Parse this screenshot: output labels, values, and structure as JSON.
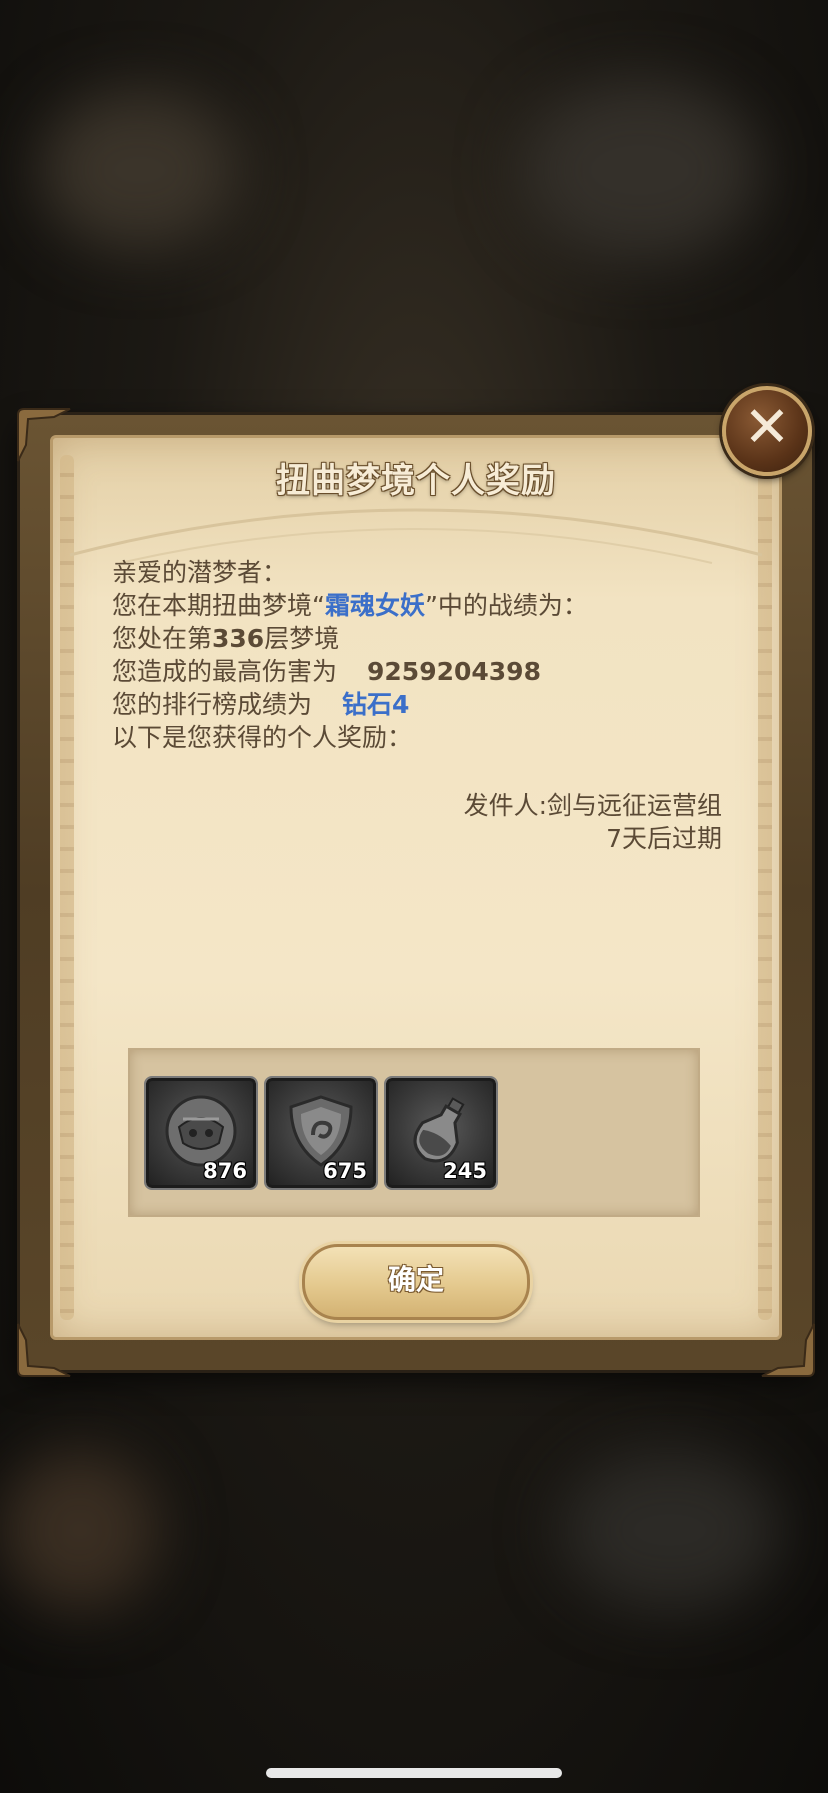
{
  "dialog": {
    "title": "扭曲梦境个人奖励",
    "greeting": "亲爱的潜梦者：",
    "line2_prefix": "您在本期扭曲梦境“",
    "boss_name": "霜魂女妖",
    "line2_suffix": "”中的战绩为：",
    "line3_prefix": "您处在第",
    "floor": "336",
    "line3_suffix": "层梦境",
    "line4_label": "您造成的最高伤害为",
    "damage": "9259204398",
    "line5_label": "您的排行榜成绩为",
    "rank": "钻石4",
    "line6": "以下是您获得的个人奖励：",
    "sender": "发件人:剑与远征运营组",
    "expiry": "7天后过期",
    "confirm_label": "确定"
  },
  "rewards": [
    {
      "icon": "mask-token-icon",
      "count": "876"
    },
    {
      "icon": "shield-emblem-icon",
      "count": "675"
    },
    {
      "icon": "potion-bottle-icon",
      "count": "245"
    }
  ],
  "colors": {
    "highlight": "#3b6fc9",
    "text": "#5b4a36",
    "parchment": "#f2e3c2"
  }
}
